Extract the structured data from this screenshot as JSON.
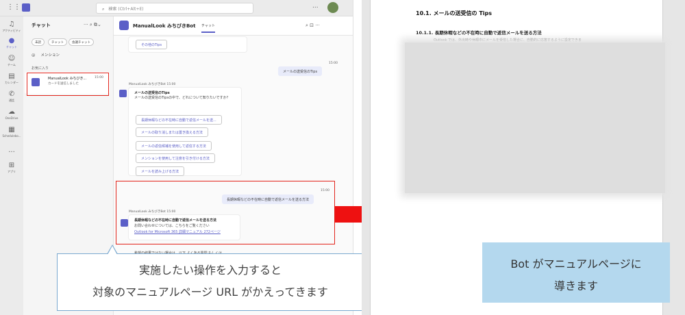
{
  "titlebar": {
    "search_placeholder": "検索 (Ctrl+Alt+E)",
    "more": "..."
  },
  "rail": [
    {
      "label": "アクティビティ",
      "icon": "bell-icon"
    },
    {
      "label": "チャット",
      "icon": "chat-icon",
      "active": true
    },
    {
      "label": "チーム",
      "icon": "teams-icon"
    },
    {
      "label": "カレンダー",
      "icon": "calendar-icon"
    },
    {
      "label": "通話",
      "icon": "phone-icon"
    },
    {
      "label": "OneDrive",
      "icon": "cloud-icon"
    },
    {
      "label": "Schedulebo...",
      "icon": "schedule-icon"
    },
    {
      "label": "...",
      "icon": "more-icon"
    },
    {
      "label": "アプリ",
      "icon": "apps-icon"
    }
  ],
  "chatlist": {
    "title": "チャット",
    "icons": "···  ⌕  ⧉⌄",
    "filters": [
      "未読",
      "チャット",
      "会議チャット"
    ],
    "mention": "メンション",
    "favorites": "お気に入り",
    "item": {
      "name": "ManualLook みちびき...",
      "time": "15:00",
      "preview": "カードを送信しました"
    }
  },
  "chat": {
    "bot_name": "ManualLook みちびきBot",
    "tab": "チャット",
    "header_icons": "⌕  ⊡  ···",
    "other_tips": "その他のTips",
    "msg1_time": "15:00",
    "msg1": "メールの送受信のTips",
    "bot_sender1": "ManualLook みちびきBot  15:00",
    "card1_title": "メールの送受信のTips",
    "card1_sub": "メールの送受信のTipsの中で、どれについて知りたいですか？",
    "options": [
      "長期休暇などの不在時に自動で返信メールを送...",
      "メールの取り消しまたは置き換える方法",
      "メールの返信候補を使用して返信する方法",
      "メンションを使用して注意を引き付ける方法",
      "メールを読み上げる方法"
    ],
    "msg2_time": "15:00",
    "msg2": "長期休暇などの不在時に自動で返信メールを送る方法",
    "bot_sender2": "ManualLook みちびきBot  15:00",
    "card2_title": "長期休暇などの不在時に自動で返信メールを送る方法",
    "card2_sub": "お問い合わせについては、こちらをご覧ください",
    "card2_link": "Outlook for Microsoft 365 詳細マニュアル 272ページ",
    "card3_text": "希望の結果ではない場合は、以下 よくある質問 もしくは"
  },
  "callout": {
    "line1": "実施したい操作を入力すると",
    "line2": "対象のマニュアルページ URL がかえってきます"
  },
  "manual": {
    "heading1": "10.1.  メールの送受信の Tips",
    "heading2": "10.1.1.  長期休暇などの不在時に自動で返信メールを送る方法",
    "body": "Outlook では、外出時や休暇中にメールを受信した場合に、自動的に応答するように設定できま",
    "box_line1": "Bot がマニュアルページに",
    "box_line2": "導きます"
  },
  "colors": {
    "accent": "#5b5fc7",
    "highlight_red": "#e2231a",
    "callout_blue": "#b4d8ee"
  }
}
